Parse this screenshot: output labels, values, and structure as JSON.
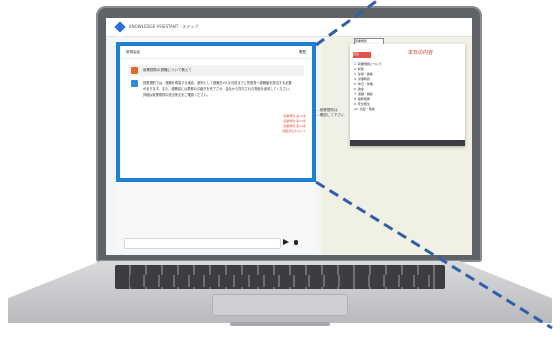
{
  "app": {
    "title": "KNOWLEDGE ASSISTANT - ステップ"
  },
  "chat": {
    "header_left": "新規会話",
    "header_right": "履歴",
    "question": "就業規則の退職について教えて",
    "answer": "就業規則では、退職を希望する場合、原則として退職日の1か月前までに所属長へ退職届を提出する必要があります。また、退職前には業務の引継ぎを完了させ、会社から貸与された物品を返却してください。詳細は就業規則の該当条文をご確認ください。",
    "refs": [
      "就業規則 第12条",
      "就業規則 第13条",
      "就業規則 第14条",
      "退職手続きガイド"
    ]
  },
  "doc": {
    "tab": "就業規則",
    "popup_title": "本日の内容",
    "tag": "目次",
    "toc": [
      "1. 就業規則について",
      "2. 総則",
      "3. 採用・異動",
      "4. 労働時間",
      "5. 休日・休暇",
      "6. 賃金",
      "7. 退職・解雇",
      "8. 服務規律",
      "9. 安全衛生",
      "10. 表彰・懲戒"
    ],
    "side_text": [
      "…就業規則は",
      "…確認して下さい"
    ]
  },
  "colors": {
    "highlight": "#1f7fd0",
    "dash": "#2f5fa8"
  }
}
